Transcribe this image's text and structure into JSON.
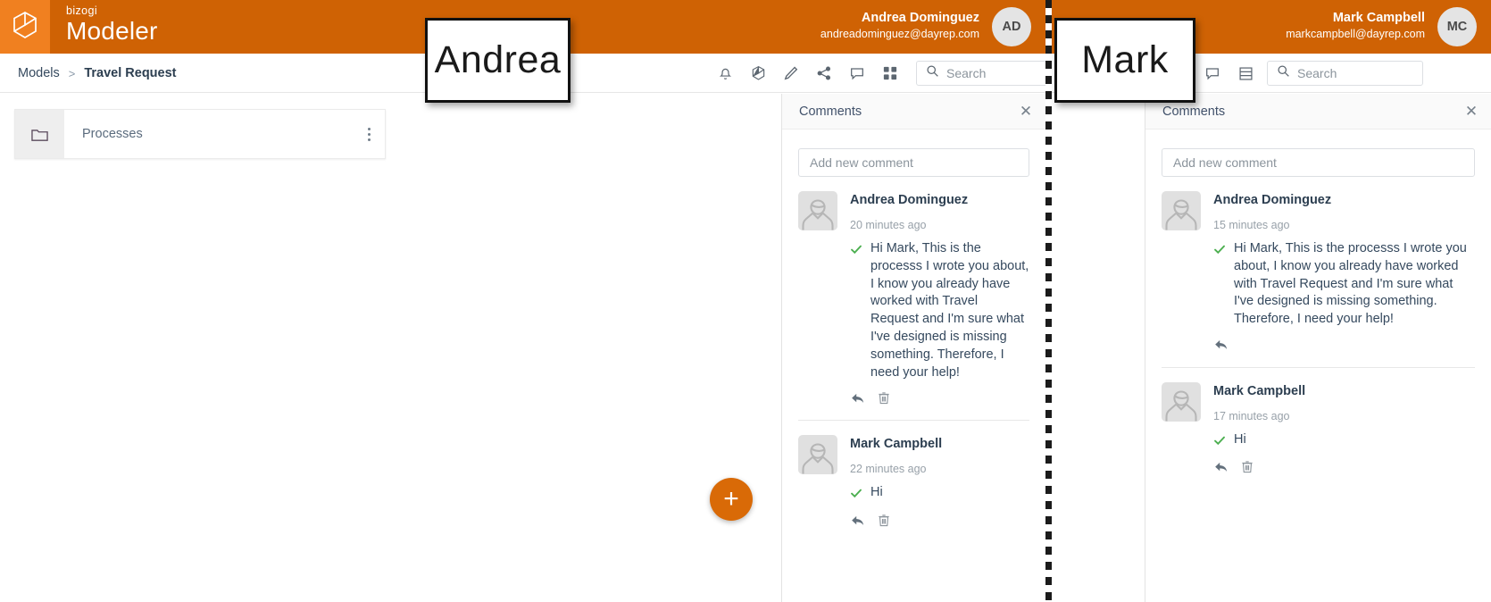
{
  "brand": {
    "small": "bizogi",
    "name": "Modeler",
    "logo_icon": "cube-icon",
    "square_color": "#f08020",
    "bar_color": "#cf6204"
  },
  "panes": {
    "left": {
      "user": {
        "name": "Andrea Dominguez",
        "email": "andreadominguez@dayrep.com",
        "initials": "AD"
      },
      "callout": "Andrea",
      "breadcrumb": {
        "root": "Models",
        "separator": ">",
        "current": "Travel Request"
      },
      "toolbar_icons": [
        "bell-icon",
        "cube-icon",
        "pencil-icon",
        "share-icon",
        "comment-icon",
        "grid-icon"
      ],
      "search": {
        "placeholder": "Search",
        "icon": "search-icon"
      },
      "folder": {
        "name": "Processes",
        "icon": "folder-icon",
        "menu_icon": "kebab-menu-icon"
      },
      "fab": {
        "label": "+",
        "color": "#d96a07"
      },
      "comments": {
        "title": "Comments",
        "close_icon": "close-icon",
        "new_comment_placeholder": "Add new comment",
        "items": [
          {
            "author": "Andrea Dominguez",
            "time": "20 minutes ago",
            "text": "Hi Mark, This is the processs I wrote you about, I know you already have worked with Travel Request and I'm sure what I've designed is missing something. Therefore, I need your help!",
            "status_icon": "check-icon",
            "actions": [
              "reply-icon",
              "delete-icon"
            ]
          },
          {
            "author": "Mark Campbell",
            "time": "22 minutes ago",
            "text": "Hi",
            "status_icon": "check-icon",
            "actions": [
              "reply-icon",
              "delete-icon"
            ]
          }
        ]
      }
    },
    "right": {
      "user": {
        "name": "Mark Campbell",
        "email": "markcampbell@dayrep.com",
        "initials": "MC"
      },
      "callout": "Mark",
      "toolbar_icons": [
        "comment-icon",
        "list-icon"
      ],
      "search": {
        "placeholder": "Search",
        "icon": "search-icon"
      },
      "comments": {
        "title": "Comments",
        "close_icon": "close-icon",
        "new_comment_placeholder": "Add new comment",
        "items": [
          {
            "author": "Andrea Dominguez",
            "time": "15 minutes ago",
            "text": "Hi Mark, This is the processs I wrote you about, I know you already have worked with Travel Request and I'm sure what I've designed is missing something. Therefore, I need your help!",
            "status_icon": "check-icon",
            "actions": [
              "reply-icon"
            ]
          },
          {
            "author": "Mark Campbell",
            "time": "17 minutes ago",
            "text": "Hi",
            "status_icon": "check-icon",
            "actions": [
              "reply-icon",
              "delete-icon"
            ]
          }
        ]
      }
    }
  },
  "colors": {
    "accent": "#cf6204",
    "accent_light": "#f08020",
    "check": "#4caf50",
    "text": "#35495e"
  }
}
